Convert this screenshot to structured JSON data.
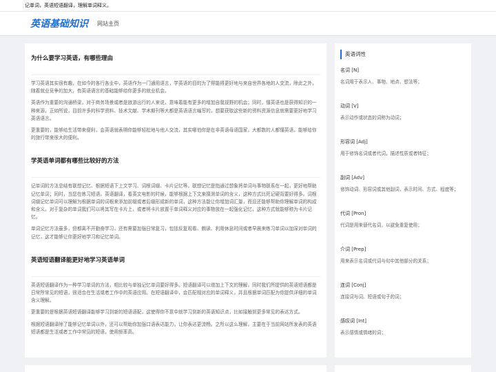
{
  "topbar": {
    "text": "记单词，英语短语翻译，理解单词释义。"
  },
  "header": {
    "logo": "英语基础知识",
    "nav_home": "网站主页"
  },
  "main": {
    "sections": [
      {
        "title": "为什么要学习英语，有哪些理由",
        "paragraphs": [
          "学习英语其实很有趣，在如今的各行各业中，英语作为一门通用语言，学英语的目的为了得能得更好地与来自世界各地的人交流，除此之外，随着就业竞争的加大，有英语语言的基础能够给你更多的就业机会。",
          "英语作为重要的沟通桥梁，对于商务场景或者是旅游出行的人来说，意味着能有更多的增加自我视野的机会；同时，懂英语也是获得知识的一种来源，正如所说，目前许多的科学资料、技术文献、学术期刊等大都是英语语言编写的，想要获取这些新的资料资源信息就需要更好地学习英语语言。",
          "更重要的，能够给生活带来便利，会英语就表明你能够轻松地与他人交流，其实哪怕你是在非英语母语国家，大都数的人都懂英语，能够给你的旅行带来很大的便利。"
        ]
      },
      {
        "title": "学英语单词都有哪些比较好的方法",
        "paragraphs": [
          "记单词的方法总结有联想记忆、根据短语下上文学习、词根词缀、卡片记忆等。联想记忆是指通过想象将单词与事物联系在一起，更好地帮助记忆单词；同时，当您在练习短语，英语翻译，看英文电影的时候，能够根据上下文来猜测单词的含义，这种方式比死记硬背要好得多。词根词缀记忆单词可以理解为根据单词的词根来添加前缀或者后缀形成新的单词，这种方法能让你增加词汇量，而且还能够帮助你理解单词的构成和含义。对于复杂的单词我们可以将其写在卡片上，或者将卡片放置于单词释义对应的事物放在一起强化记忆，这种方式就能够称为卡片记忆。",
          "单词记忆方法虽多，但都离不开勤奋学习，还有需要加强日常复习，包括反复观看、朗读、利用休息时间或者早晨来练习单词以加深对单词的记忆，这才能够让你更好地学习和记忆单词。"
        ]
      },
      {
        "title": "英语短语翻译能更好地学习英语单词",
        "paragraphs": [
          "英语短语翻译作为一种学习单词的方法，相比较与单独记忆单词要好得多。短语翻译可以增加上下文的理解，同时我们所提供的英语短语都是日常所常见的短语，很适合在生活或者工作中的英语应用。在短语翻译中，会匹配相对应的单词释义，并且根据单词匹配为你提供详细的单词含义理解。",
          "更重要的是根据英语短语翻译能够学习到新的短语语配，这使得你不意中就学习到新的英语知识点，比如接触到更多常见的表达方式。",
          "根据短语翻译除了能够记忆单词以外，还可以帮助你加强口语表达能力，让你表达更流畅。之所以这么理解，主要在于当前网站所发表的英语短语都是生活或者工作中常见的短语，使用频率高。"
        ]
      }
    ]
  },
  "sidebar": {
    "title": "英语词性",
    "terms": [
      {
        "name": "名词 [N]",
        "desc": "名词用于表示人、事物、地点、想法等；"
      },
      {
        "name": "动词 [V]",
        "desc": "表示动作或状态的词称为动词；"
      },
      {
        "name": "形容词 [Adj]",
        "desc": "用于修饰名词或者代词，描述性质或者特征；"
      },
      {
        "name": "副词 [Adv]",
        "desc": "修饰动词、形容词或其他副词，表示时间、方式、程度等；"
      },
      {
        "name": "代词 [Pron]",
        "desc": "代词是用来替代名词，以避免重复使用；"
      },
      {
        "name": "介词 [Prep]",
        "desc": "用来表示名词或代词与句中其他部分的关系；"
      },
      {
        "name": "连词 [Conj]",
        "desc": "连接词与词、短语或句子的词；"
      },
      {
        "name": "感叹词 [Int]",
        "desc": "表示感情或情绪的词；"
      }
    ]
  }
}
